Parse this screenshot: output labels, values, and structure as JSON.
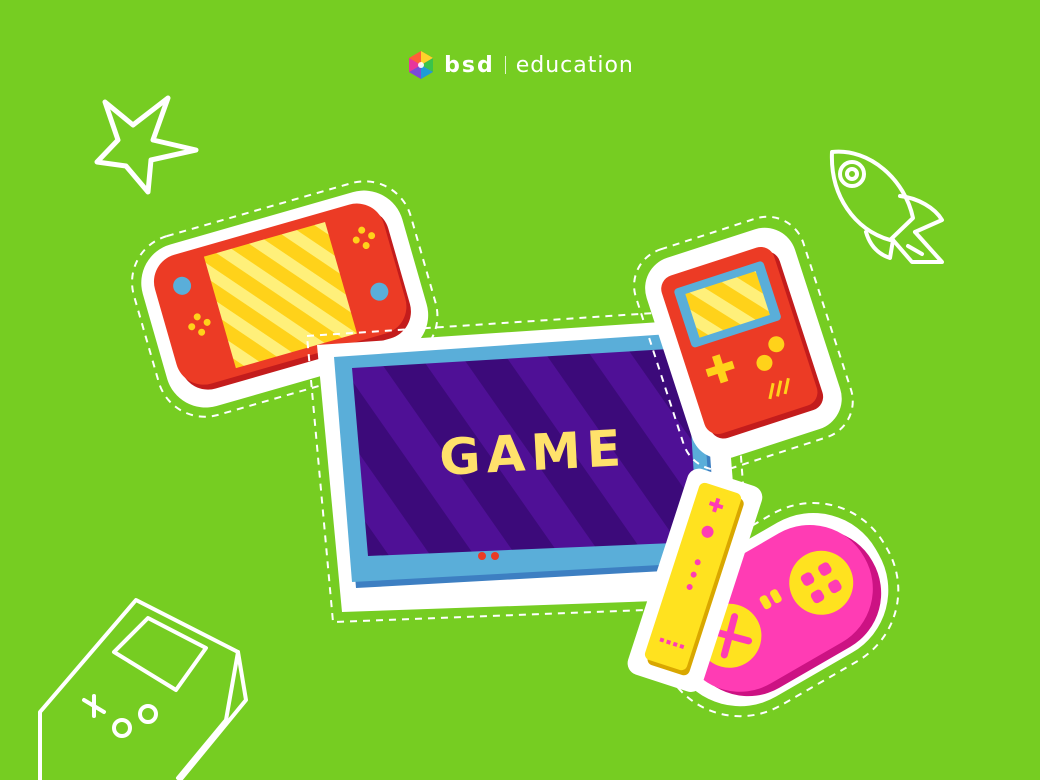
{
  "logo": {
    "brand": "bsd",
    "word": "education"
  },
  "screen": {
    "title": "GAME"
  },
  "colors": {
    "background": "#76cd22",
    "tablet_frame": "#5aaed9",
    "tablet_screen": "#3c0a7a",
    "title_text": "#ffe16b",
    "red_device": "#e63b2a",
    "yellow": "#ffe21f",
    "pink": "#ff3cb4"
  },
  "icons": [
    "star-doodle-icon",
    "rocket-doodle-icon",
    "handheld-doodle-icon",
    "switch-console-icon",
    "tablet-icon",
    "gameboy-icon",
    "remote-controller-icon",
    "gamepad-icon"
  ]
}
